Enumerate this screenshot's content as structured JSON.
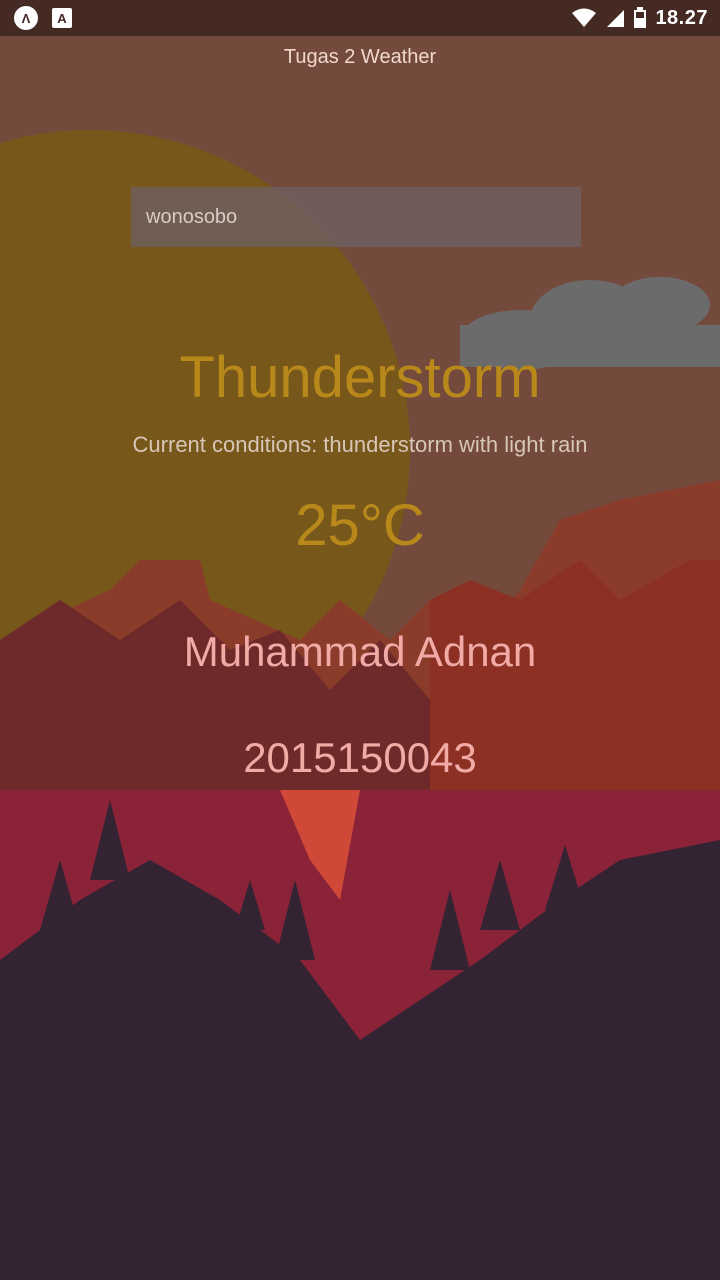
{
  "status_bar": {
    "time": "18.27",
    "app_icon_1": "Λ",
    "app_icon_2": "A",
    "icons": [
      "wifi-icon",
      "signal-icon",
      "battery-icon"
    ]
  },
  "app": {
    "title": "Tugas 2 Weather"
  },
  "search": {
    "value": "wonosobo"
  },
  "weather": {
    "main": "Thunderstorm",
    "conditions": "Current conditions: thunderstorm with light rain",
    "temperature": "25°C"
  },
  "student": {
    "name": "Muhammad Adnan",
    "id": "2015150043"
  },
  "colors": {
    "headline": "#b8891a",
    "name": "#f1aaa6",
    "status_bar": "#452a24"
  }
}
